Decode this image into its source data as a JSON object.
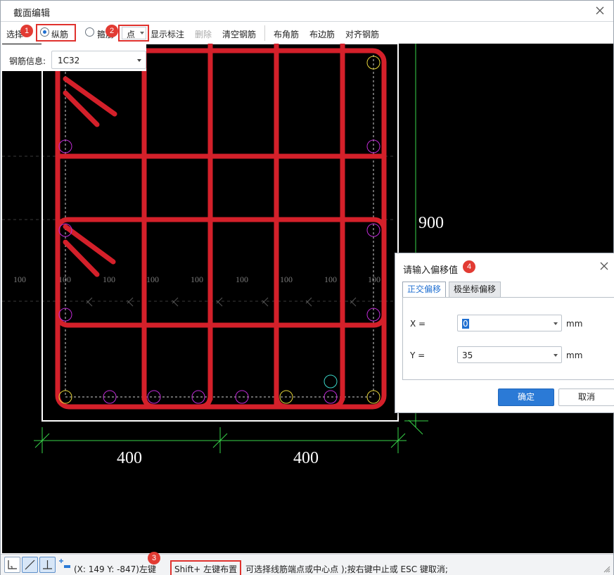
{
  "window": {
    "title": "截面编辑"
  },
  "toolbar": {
    "select_label": "选择",
    "radio_longitudinal": "纵筋",
    "radio_stirrup": "箍筋",
    "mode_value": "点",
    "show_annotation": "显示标注",
    "delete": "删除",
    "clear_rebar": "清空钢筋",
    "corner_rebar": "布角筋",
    "edge_rebar": "布边筋",
    "align_rebar": "对齐钢筋"
  },
  "rebar_info": {
    "label": "钢筋信息:",
    "value": "1C32"
  },
  "drawing": {
    "dim_height": "900",
    "dim_width_left": "400",
    "dim_width_right": "400",
    "spacing_labels": [
      "100",
      "100",
      "100",
      "100",
      "100",
      "100",
      "100",
      "100",
      "100"
    ]
  },
  "badges": [
    "1",
    "2",
    "3",
    "4"
  ],
  "statusbar": {
    "coords": "(X: 149 Y: -847)",
    "message_pre": "左键",
    "message_highlight": "Shift+ 左键布置",
    "message_post": "可选择线筋端点或中心点 );按右键中止或 ESC 键取消;"
  },
  "dialog": {
    "title": "请输入偏移值",
    "tabs": [
      "正交偏移",
      "极坐标偏移"
    ],
    "x_label": "X =",
    "x_value": "0",
    "y_label": "Y =",
    "y_value": "35",
    "unit": "mm",
    "ok": "确定",
    "cancel": "取消"
  },
  "colors": {
    "rebar": "#d4202a",
    "dim": "#39d64a",
    "accent": "#2b7ad6",
    "badge": "#e23b33"
  }
}
